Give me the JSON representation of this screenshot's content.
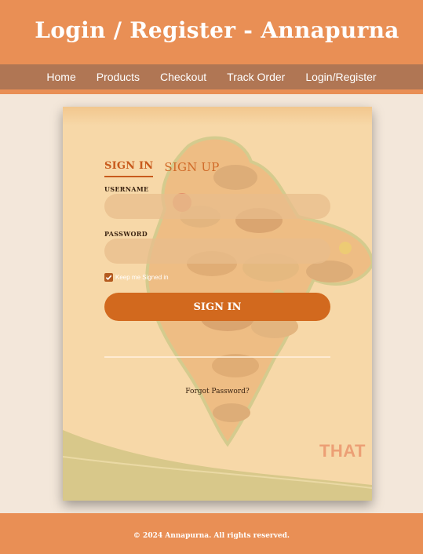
{
  "header": {
    "title": "Login / Register - Annapurna"
  },
  "nav": {
    "items": [
      {
        "label": "Home"
      },
      {
        "label": "Products"
      },
      {
        "label": "Checkout"
      },
      {
        "label": "Track Order"
      },
      {
        "label": "Login/Register"
      }
    ]
  },
  "auth": {
    "tabs": [
      {
        "label": "SIGN IN",
        "active": true
      },
      {
        "label": "SIGN UP",
        "active": false
      }
    ],
    "username_label": "USERNAME",
    "username_value": "",
    "password_label": "PASSWORD",
    "password_value": "",
    "remember_label": "Keep me Signed in",
    "remember_checked": true,
    "signin_button": "SIGN IN",
    "forgot_link": "Forgot Password?",
    "watermark": "THAT"
  },
  "footer": {
    "text": "© 2024 Annapurna. All rights reserved."
  },
  "colors": {
    "header_bg": "#e98f55",
    "nav_bg": "#b07654",
    "accent": "#d2691e",
    "card_bg": "#f7d8a8",
    "page_bg": "#f3e7da"
  }
}
